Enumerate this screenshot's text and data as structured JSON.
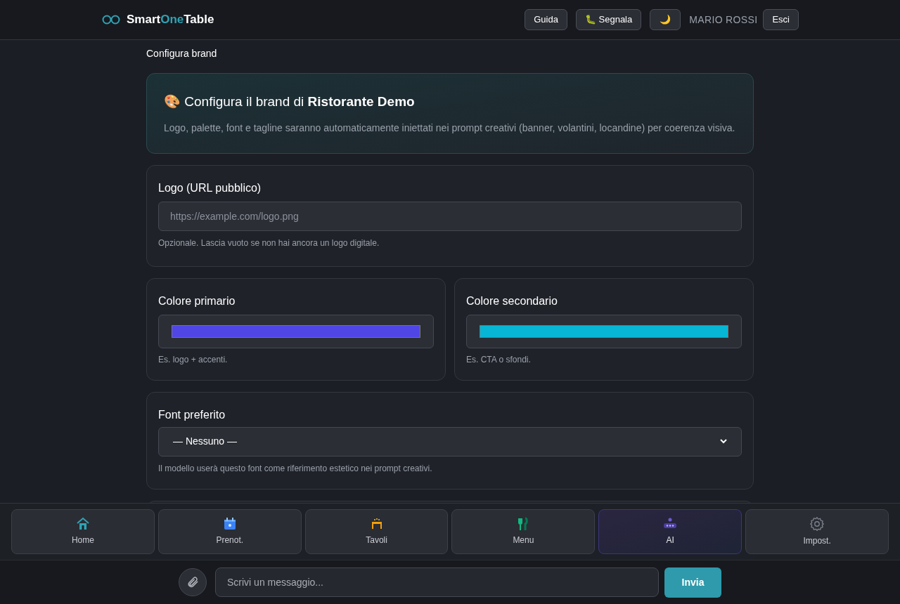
{
  "header": {
    "brand": {
      "parts": [
        "Smart",
        "One",
        "Table"
      ]
    },
    "buttons": [
      {
        "kind": "text",
        "label": "Guida"
      },
      {
        "kind": "text",
        "label": "🐛 Segnala"
      },
      {
        "kind": "text",
        "label": "🌙"
      }
    ],
    "user": "MARIO ROSSI",
    "logout": "Esci"
  },
  "breadcrumb": "Configura brand",
  "hero": {
    "title": "🎨 Configura il brand di **Ristorante Demo**",
    "text": "Logo, palette, font e tagline saranno automaticamente iniettati nei prompt creativi (banner, volantini, locandine) per coerenza visiva."
  },
  "logo": {
    "label": "Logo (URL pubblico)",
    "placeholder": "https://example.com/logo.png",
    "hint": "Opzionale. Lascia vuoto se non hai ancora un logo digitale."
  },
  "colors": [
    {
      "label": "Colore primario",
      "color": "#4f46e5",
      "hint": "Es. logo + accenti."
    },
    {
      "label": "Colore secondario",
      "color": "#06b6d4",
      "hint": "Es. CTA o sfondi."
    }
  ],
  "font": {
    "label": "Font preferito",
    "value": "— Nessuno —",
    "hint": "Il modello userà questo font come riferimento estetico nei prompt creativi."
  },
  "nav": [
    {
      "kind": "home",
      "label": "Home",
      "selected": false
    },
    {
      "kind": "calendar",
      "label": "Prenot.",
      "selected": false
    },
    {
      "kind": "table",
      "label": "Tavoli",
      "selected": false
    },
    {
      "kind": "menu",
      "label": "Menu",
      "selected": false
    },
    {
      "kind": "ai",
      "label": "AI",
      "selected": true
    },
    {
      "kind": "settings",
      "label": "Impost.",
      "selected": false
    }
  ],
  "chat": {
    "placeholder": "Scrivi un messaggio...",
    "send": "Invia"
  }
}
